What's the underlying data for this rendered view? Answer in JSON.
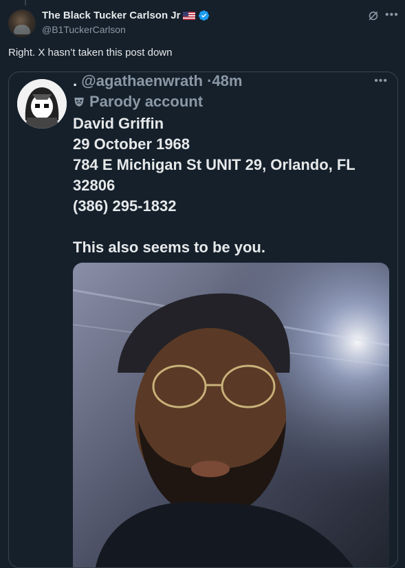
{
  "post": {
    "author": {
      "display_name": "The Black Tucker Carlson Jr",
      "handle": "@B1TuckerCarlson",
      "flag": "us-flag",
      "verified": true
    },
    "text": "Right. X hasn’t taken this post down",
    "icons": {
      "grok": "grok-icon",
      "more": "more-icon"
    }
  },
  "quoted_post": {
    "display_name": ".",
    "handle": "@agathaenwrath",
    "separator": "·",
    "time": "48m",
    "label": "Parody account",
    "lines": [
      "David Griffin",
      "29 October 1968",
      "784 E Michigan St UNIT 29, Orlando, FL 32806",
      "(386) 295-1832"
    ],
    "text2": "This also seems to be you."
  },
  "colors": {
    "background": "#15202b",
    "text_primary": "#e7e9ea",
    "text_secondary": "#8b98a5",
    "border": "#38444d",
    "verified": "#1d9bf0"
  }
}
